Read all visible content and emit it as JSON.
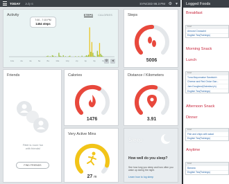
{
  "topbar": {
    "today": "TODAY",
    "date": "July 6",
    "synced": "SYNCED 98.3 PM"
  },
  "activity": {
    "title": "Activity",
    "tabs": [
      "STEPS",
      "CALORIES"
    ],
    "tooltip": {
      "time": "7:00 - 7:15 PM",
      "value": "1454 steps"
    },
    "ticks": [
      "12a",
      "2a",
      "4a",
      "6a",
      "8a",
      "10a",
      "12p",
      "2p",
      "4p",
      "6p",
      "8p",
      "10p"
    ],
    "chart_data": {
      "type": "bar",
      "xlabel": "",
      "ylabel": "",
      "values": [
        0,
        0,
        0,
        0,
        0,
        0,
        0,
        0,
        0,
        0,
        0,
        0,
        0,
        0,
        0,
        0,
        0,
        0,
        0,
        0,
        0,
        0,
        0,
        0,
        0,
        0,
        0,
        0,
        0,
        0,
        0,
        0,
        0,
        0,
        1,
        2,
        0,
        1,
        0,
        3,
        2,
        0,
        1,
        0,
        0,
        8,
        2,
        1,
        0,
        3,
        0,
        1,
        0,
        0,
        1,
        2,
        0,
        0,
        0,
        0,
        1,
        0,
        0,
        1,
        0,
        0,
        2,
        0,
        0,
        1,
        3,
        2,
        4,
        60,
        10,
        30,
        8,
        2,
        1,
        0,
        12,
        4,
        28,
        6,
        3,
        1,
        0,
        0,
        0,
        0,
        0,
        0,
        0,
        0,
        0,
        0
      ],
      "ylim": [
        0,
        65
      ]
    }
  },
  "steps": {
    "title": "Steps",
    "value": "5006",
    "progress": 0.5
  },
  "friends": {
    "title": "Friends",
    "text1": "Fitbit is more fun",
    "text2": "with friends!",
    "button": "FIND FRIENDS"
  },
  "calories": {
    "title": "Calories",
    "value": "1476",
    "progress": 0.6
  },
  "distance": {
    "title": "Distance / Kilometers",
    "value": "3.91",
    "progress": 0.55
  },
  "active_mins": {
    "title": "Very Active Mins",
    "value": "27",
    "unit": "m",
    "progress": 0.9
  },
  "sleep": {
    "title": "Sleep",
    "question": "How well do you sleep?",
    "desc": "See how long you sleep and how often you wake up during the night.",
    "link": "Learn how to log sleep"
  },
  "foods": {
    "title": "Logged Foods",
    "meals": [
      {
        "name": "Breakfast",
        "box_head": "Food",
        "items": [
          "Almond Crossaint",
          "English Tea(Twinings)"
        ]
      },
      {
        "name": "Morning Snack",
        "box_head": "",
        "items": []
      },
      {
        "name": "Lunch",
        "box_head": "Food",
        "items": [
          "Tuna Mayonnaise Sandwich",
          "Cheese and Red Onion San...",
          "Jam Doughnut(Sainsbury's)",
          "English Tea(Twinings)"
        ]
      },
      {
        "name": "Afternoon Snack",
        "box_head": "",
        "items": []
      },
      {
        "name": "Dinner",
        "box_head": "Food",
        "items": [
          "Fish and chips with salad",
          "English Tea(Twinings)"
        ]
      },
      {
        "name": "Anytime",
        "box_head": "Food",
        "items": [
          "Banana",
          "English Tea(Twinings)"
        ]
      }
    ]
  },
  "colors": {
    "accent_red": "#e8483c",
    "active_yellow": "#f2c418",
    "meal_red": "#c8283e",
    "bar_green": "#9dc03a",
    "bar_yellow": "#e9c420"
  }
}
